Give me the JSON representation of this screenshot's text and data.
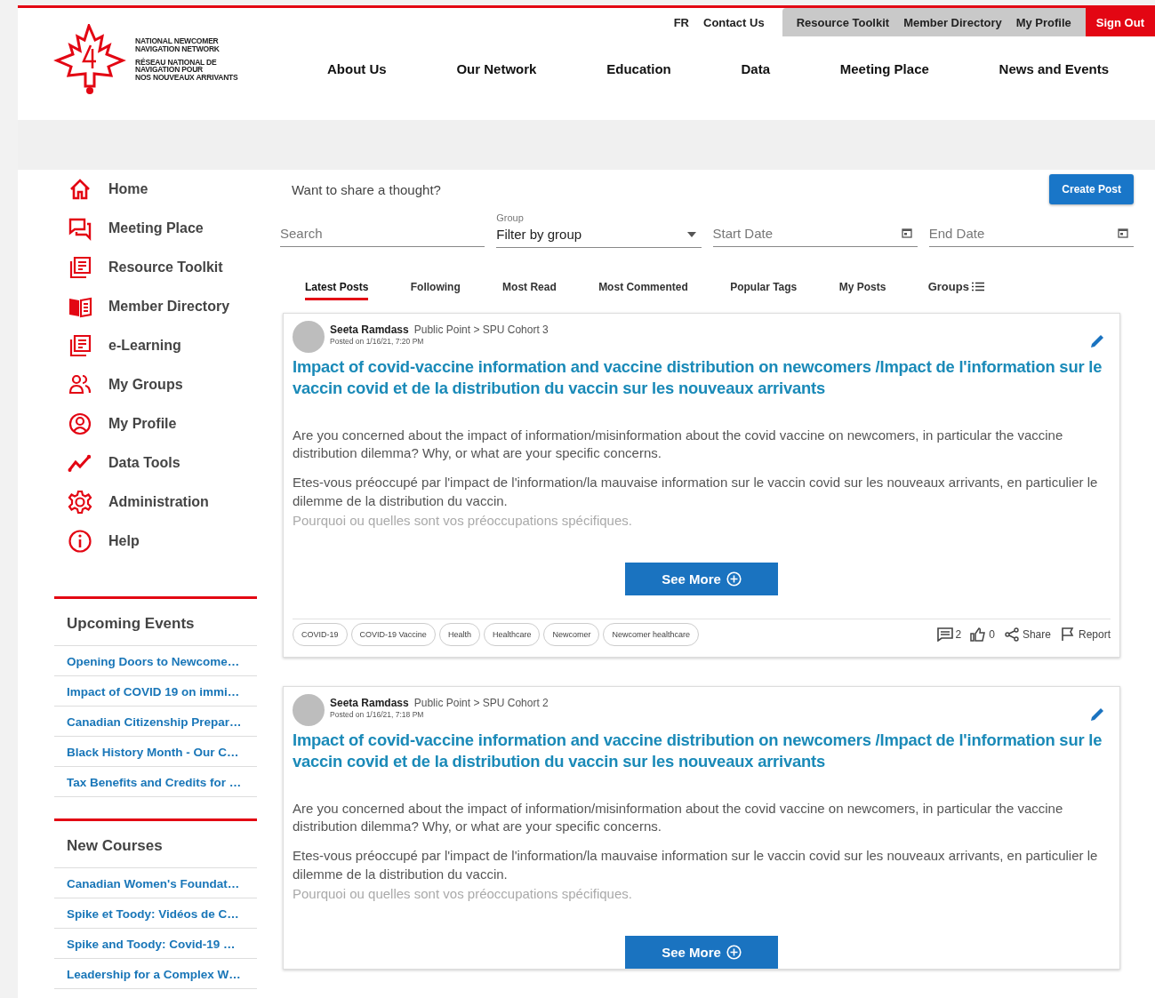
{
  "utility_links": [
    "FR",
    "Contact Us"
  ],
  "member_links": [
    "Resource Toolkit",
    "Member Directory",
    "My Profile"
  ],
  "sign_out": "Sign Out",
  "logo": {
    "lines_en": [
      "NATIONAL NEWCOMER",
      "NAVIGATION NETWORK"
    ],
    "lines_fr": [
      "RÉSEAU NATIONAL DE",
      "NAVIGATION POUR",
      "NOS NOUVEAUX ARRIVANTS"
    ]
  },
  "main_nav": [
    "About Us",
    "Our Network",
    "Education",
    "Data",
    "Meeting Place",
    "News and Events"
  ],
  "sidebar": {
    "items": [
      {
        "label": "Home",
        "kind": "home"
      },
      {
        "label": "Meeting Place",
        "kind": "chat"
      },
      {
        "label": "Resource Toolkit",
        "kind": "docs"
      },
      {
        "label": "Member Directory",
        "kind": "book"
      },
      {
        "label": "e-Learning",
        "kind": "docs"
      },
      {
        "label": "My Groups",
        "kind": "group"
      },
      {
        "label": "My Profile",
        "kind": "profile"
      },
      {
        "label": "Data Tools",
        "kind": "chart"
      },
      {
        "label": "Administration",
        "kind": "gear"
      },
      {
        "label": "Help",
        "kind": "info"
      }
    ],
    "sections": [
      {
        "title": "Upcoming Events",
        "links": [
          "Opening Doors to Newcome…",
          "Impact of COVID 19 on immi…",
          "Canadian Citizenship Prepar…",
          "Black History Month - Our C…",
          "Tax Benefits and Credits for …"
        ]
      },
      {
        "title": "New Courses",
        "links": [
          "Canadian Women's Foundat…",
          "Spike et Toody: Vidéos de C…",
          "Spike and Toody: Covid-19 …",
          "Leadership for a Complex W…"
        ]
      }
    ]
  },
  "composer": {
    "prompt": "Want to share a thought?",
    "button": "Create Post"
  },
  "filters": {
    "search": {
      "placeholder": "Search"
    },
    "group": {
      "label": "Group",
      "value": "Filter by group"
    },
    "start_date": {
      "placeholder": "Start Date"
    },
    "end_date": {
      "placeholder": "End Date"
    }
  },
  "tabs": [
    {
      "label": "Latest Posts",
      "selected": true
    },
    {
      "label": "Following",
      "selected": false
    },
    {
      "label": "Most Read",
      "selected": false
    },
    {
      "label": "Most Commented",
      "selected": false
    },
    {
      "label": "Popular Tags",
      "selected": false
    },
    {
      "label": "My Posts",
      "selected": false
    },
    {
      "label": "Groups",
      "selected": false
    }
  ],
  "posts": [
    {
      "author": "Seeta Ramdass",
      "group_path": "Public Point > SPU Cohort 3",
      "posted": "Posted on 1/16/21, 7:20 PM",
      "title": "Impact of covid-vaccine information and vaccine distribution on newcomers /Impact de l'information sur le vaccin covid et de la distribution du vaccin sur les nouveaux arrivants",
      "paragraphs": [
        "Are you concerned about the impact of  information/misinformation about the covid vaccine on newcomers, in particular the vaccine distribution dilemma? Why, or what are your specific concerns.",
        "Etes-vous préoccupé par l'impact de l'information/la mauvaise information sur le vaccin covid sur les nouveaux arrivants, en particulier le dilemme de la distribution du vaccin.",
        "Pourquoi ou quelles sont vos préoccupations spécifiques."
      ],
      "see_more": "See More",
      "tags": [
        "COVID-19",
        "COVID-19 Vaccine",
        "Health",
        "Healthcare",
        "Newcomer",
        "Newcomer healthcare"
      ],
      "comments": "2",
      "likes": "0",
      "share": "Share",
      "report": "Report"
    },
    {
      "author": "Seeta Ramdass",
      "group_path": "Public Point > SPU Cohort 2",
      "posted": "Posted on 1/16/21, 7:18 PM",
      "title": "Impact of covid-vaccine information and vaccine distribution on newcomers /Impact de l'information sur le vaccin covid et de la distribution du vaccin sur les nouveaux arrivants",
      "paragraphs": [
        "Are you concerned about the impact of  information/misinformation about the covid vaccine on newcomers, in particular the vaccine distribution dilemma? Why, or what are your specific concerns.",
        "Etes-vous préoccupé par l'impact de l'information/la mauvaise information sur le vaccin covid sur les nouveaux arrivants, en particulier le dilemme de la distribution du vaccin.",
        "Pourquoi ou quelles sont vos préoccupations spécifiques."
      ],
      "see_more": "See More"
    }
  ]
}
